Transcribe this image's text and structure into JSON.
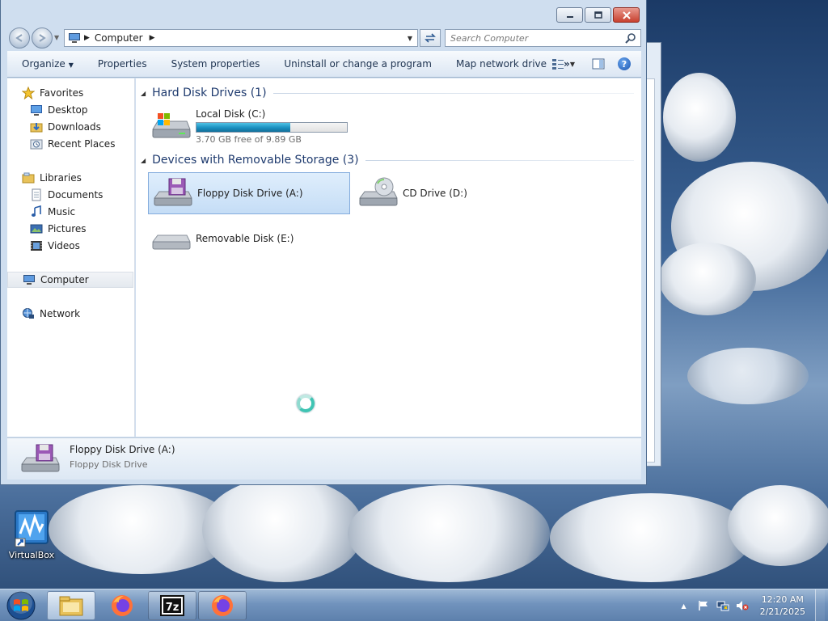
{
  "window": {
    "address_path": "Computer",
    "search_placeholder": "Search Computer"
  },
  "toolbar": {
    "organize": "Organize",
    "properties": "Properties",
    "system_properties": "System properties",
    "uninstall": "Uninstall or change a program",
    "map_drive": "Map network drive",
    "overflow": "»"
  },
  "navpane": {
    "favorites": "Favorites",
    "desktop": "Desktop",
    "downloads": "Downloads",
    "recent_places": "Recent Places",
    "libraries": "Libraries",
    "documents": "Documents",
    "music": "Music",
    "pictures": "Pictures",
    "videos": "Videos",
    "computer": "Computer",
    "network": "Network"
  },
  "content": {
    "hdd_group": "Hard Disk Drives (1)",
    "removable_group": "Devices with Removable Storage (3)",
    "local_disk": {
      "name": "Local Disk (C:)",
      "free_text": "3.70 GB free of 9.89 GB",
      "used_fraction": 0.626
    },
    "floppy": "Floppy Disk Drive (A:)",
    "cd": "CD Drive (D:)",
    "removable": "Removable Disk (E:)"
  },
  "details": {
    "name": "Floppy Disk Drive (A:)",
    "type": "Floppy Disk Drive"
  },
  "desktop": {
    "virtualbox_label": "VirtualBox"
  },
  "taskbar": {
    "time": "12:20 AM",
    "date": "2/21/2025",
    "tray_overflow": "▲"
  }
}
